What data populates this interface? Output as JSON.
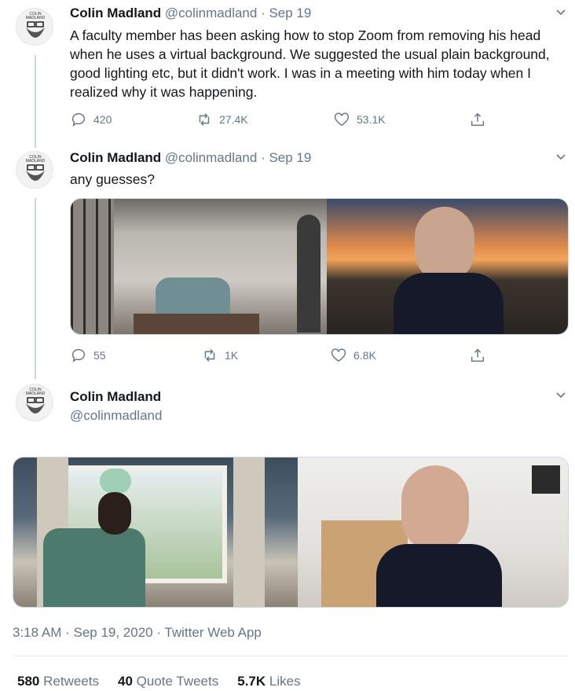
{
  "tweets": [
    {
      "name": "Colin Madland",
      "handle": "@colinmadland",
      "date": "· Sep 19",
      "text": "A faculty member has been asking how to stop Zoom from removing his head when he uses a virtual background. We suggested the usual plain background, good lighting etc, but it didn't work. I was in a meeting with him today when I realized why it was happening.",
      "replies": "420",
      "retweets": "27.4K",
      "likes": "53.1K"
    },
    {
      "name": "Colin Madland",
      "handle": "@colinmadland",
      "date": "· Sep 19",
      "text": "any guesses?",
      "replies": "55",
      "retweets": "1K",
      "likes": "6.8K"
    }
  ],
  "main_tweet": {
    "name": "Colin Madland",
    "handle": "@colinmadland",
    "timestamp": "3:18 AM · Sep 19, 2020 · Twitter Web App",
    "stats": {
      "retweets_count": "580",
      "retweets_label": "Retweets",
      "quotes_count": "40",
      "quotes_label": "Quote Tweets",
      "likes_count": "5.7K",
      "likes_label": "Likes"
    }
  },
  "avatar_text": {
    "top": "COLIN",
    "bottom": "MADLAND"
  },
  "colors": {
    "text": "#14171a",
    "secondary": "#657786",
    "line": "#ccd6dd",
    "divider": "#e6ecf0"
  },
  "icons": [
    "chevron-down-icon",
    "reply-icon",
    "retweet-icon",
    "like-icon",
    "share-icon"
  ]
}
